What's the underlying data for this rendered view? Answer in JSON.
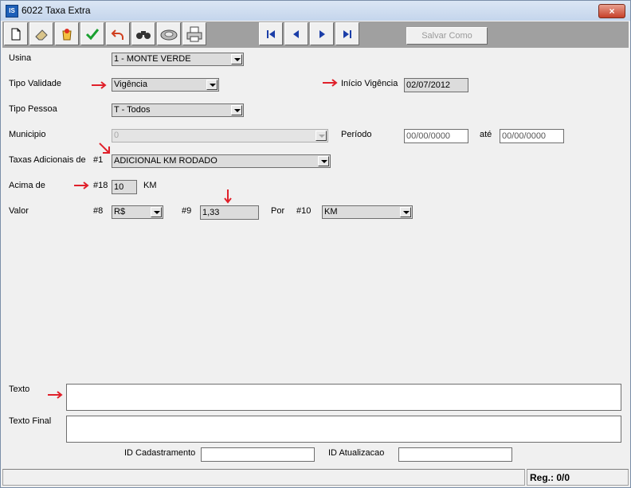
{
  "window": {
    "title": "6022 Taxa Extra",
    "icon": "app-icon",
    "close_label": "×"
  },
  "toolbar": {
    "buttons": [
      "new-document-icon",
      "eraser-icon",
      "cancel-icon",
      "confirm-check-icon",
      "undo-icon",
      "binoculars-search-icon",
      "hard-disk-save-icon",
      "printer-icon"
    ],
    "nav": [
      "first-record-icon",
      "previous-record-icon",
      "next-record-icon",
      "last-record-icon"
    ],
    "save_as_label": "Salvar Como"
  },
  "form": {
    "usina_label": "Usina",
    "usina_value": "1 - MONTE VERDE",
    "tipo_validade_label": "Tipo Validade",
    "tipo_validade_value": "Vigência",
    "inicio_vigencia_label": "Início Vigência",
    "inicio_vigencia_value": "02/07/2012",
    "tipo_pessoa_label": "Tipo Pessoa",
    "tipo_pessoa_value": "T - Todos",
    "municipio_label": "Municipio",
    "municipio_value": "0",
    "periodo_label": "Período",
    "periodo_start": "00/00/0000",
    "ate_label": "até",
    "periodo_end": "00/00/0000",
    "taxas_label": "Taxas Adicionais de",
    "taxas_tag": "#1",
    "taxas_value": "ADICIONAL KM RODADO",
    "acima_label": "Acima de",
    "acima_tag": "#18",
    "acima_value": "10",
    "acima_unit": "KM",
    "valor_label": "Valor",
    "valor_tag": "#8",
    "moeda_value": "R$",
    "valor_tag2": "#9",
    "valor_value": "1,33",
    "por_label": "Por",
    "por_tag": "#10",
    "por_value": "KM",
    "texto_label": "Texto",
    "texto_final_label": "Texto Final",
    "id_cad_label": "ID Cadastramento",
    "id_atu_label": "ID Atualizacao"
  },
  "status": {
    "reg": "Reg.: 0/0"
  },
  "colors": {
    "annotation_arrow": "#e0202a",
    "nav_blue": "#1b3ea8"
  }
}
